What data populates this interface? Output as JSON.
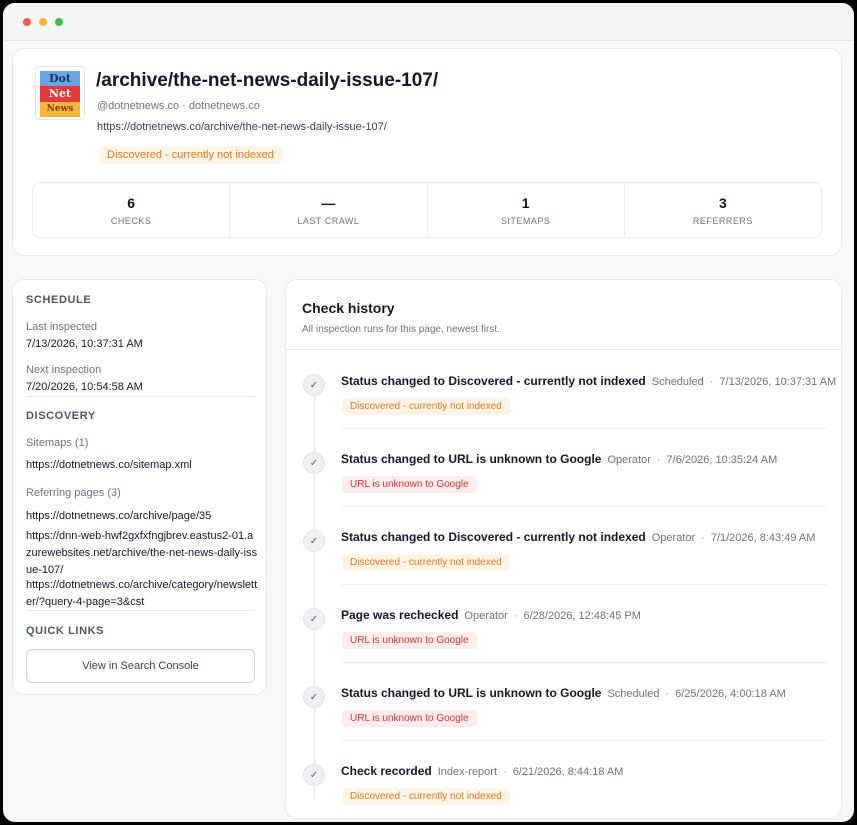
{
  "header": {
    "logo_lines": [
      "Dot",
      "Net",
      "News"
    ],
    "title": "/archive/the-net-news-daily-issue-107/",
    "handle": "@dotnetnews.co · dotnetnews.co",
    "url": "https://dotnetnews.co/archive/the-net-news-daily-issue-107/",
    "status_badge": "Discovered - currently not indexed",
    "stats": [
      {
        "value": "6",
        "label": "CHECKS"
      },
      {
        "value": "—",
        "label": "LAST CRAWL"
      },
      {
        "value": "1",
        "label": "SITEMAPS"
      },
      {
        "value": "3",
        "label": "REFERRERS"
      }
    ]
  },
  "sidebar": {
    "schedule_title": "SCHEDULE",
    "last_inspected_label": "Last inspected",
    "last_inspected_value": "7/13/2026, 10:37:31 AM",
    "next_inspection_label": "Next inspection",
    "next_inspection_value": "7/20/2026, 10:54:58 AM",
    "discovery_title": "DISCOVERY",
    "sitemaps_label": "Sitemaps (1)",
    "sitemaps": [
      "https://dotnetnews.co/sitemap.xml"
    ],
    "referring_label": "Referring pages (3)",
    "referring_pages": [
      "https://dotnetnews.co/archive/page/35",
      "https://dnn-web-hwf2gxfxfngjbrev.eastus2-01.azurewebsites.net/archive/the-net-news-daily-issue-107/",
      "https://dotnetnews.co/archive/category/newsletter/?query-4-page=3&cst"
    ],
    "quick_links_title": "QUICK LINKS",
    "console_button": "View in Search Console"
  },
  "history": {
    "title": "Check history",
    "subtitle": "All inspection runs for this page, newest first.",
    "separator": "·",
    "check_glyph": "✓",
    "entries": [
      {
        "title": "Status changed to Discovered - currently not indexed",
        "actor": "Scheduled",
        "time": "7/13/2026, 10:37:31 AM",
        "badge": "Discovered - currently not indexed",
        "badge_type": "orange"
      },
      {
        "title": "Status changed to URL is unknown to Google",
        "actor": "Operator",
        "time": "7/6/2026, 10:35:24 AM",
        "badge": "URL is unknown to Google",
        "badge_type": "red"
      },
      {
        "title": "Status changed to Discovered - currently not indexed",
        "actor": "Operator",
        "time": "7/1/2026, 8:43:49 AM",
        "badge": "Discovered - currently not indexed",
        "badge_type": "orange"
      },
      {
        "title": "Page was rechecked",
        "actor": "Operator",
        "time": "6/28/2026, 12:48:45 PM",
        "badge": "URL is unknown to Google",
        "badge_type": "red"
      },
      {
        "title": "Status changed to URL is unknown to Google",
        "actor": "Scheduled",
        "time": "6/25/2026, 4:00:18 AM",
        "badge": "URL is unknown to Google",
        "badge_type": "red"
      },
      {
        "title": "Check recorded",
        "actor": "Index-report",
        "time": "6/21/2026, 8:44:18 AM",
        "badge": "Discovered - currently not indexed",
        "badge_type": "orange"
      }
    ]
  },
  "colors": {
    "badge_orange_text": "#e07b1e",
    "badge_orange_bg": "#fff4e5",
    "badge_red_text": "#d9353b",
    "badge_red_bg": "#fdecec"
  }
}
